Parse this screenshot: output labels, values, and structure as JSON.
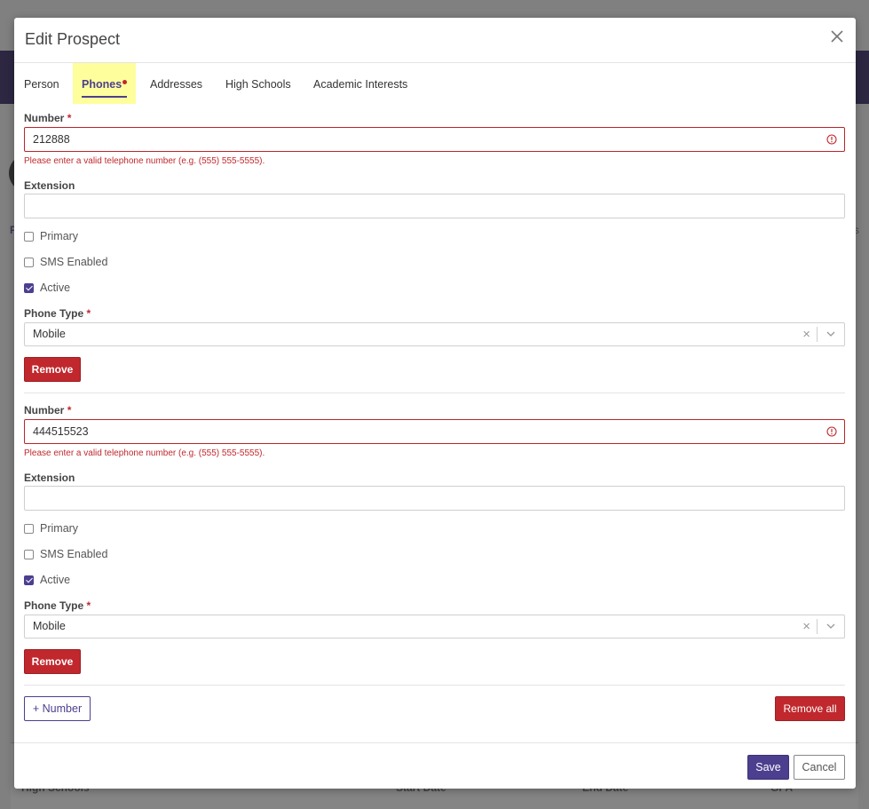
{
  "background": {
    "letter_left": "P",
    "letter_right": "s",
    "table_columns": [
      "High Schools",
      "Start Date",
      "End Date",
      "GPA"
    ]
  },
  "modal": {
    "title": "Edit Prospect",
    "close_icon": "close-icon",
    "tabs": [
      {
        "label": "Person",
        "active": false
      },
      {
        "label": "Phones",
        "active": true,
        "has_error": true
      },
      {
        "label": "Addresses",
        "active": false
      },
      {
        "label": "High Schools",
        "active": false
      },
      {
        "label": "Academic Interests",
        "active": false
      }
    ],
    "phones": [
      {
        "number_label": "Number",
        "number_value": "212888",
        "error_text": "Please enter a valid telephone number (e.g. (555) 555-5555).",
        "extension_label": "Extension",
        "extension_value": "",
        "primary_label": "Primary",
        "primary_checked": false,
        "sms_label": "SMS Enabled",
        "sms_checked": false,
        "active_label": "Active",
        "active_checked": true,
        "phone_type_label": "Phone Type",
        "phone_type_value": "Mobile",
        "remove_label": "Remove"
      },
      {
        "number_label": "Number",
        "number_value": "444515523",
        "error_text": "Please enter a valid telephone number (e.g. (555) 555-5555).",
        "extension_label": "Extension",
        "extension_value": "",
        "primary_label": "Primary",
        "primary_checked": false,
        "sms_label": "SMS Enabled",
        "sms_checked": false,
        "active_label": "Active",
        "active_checked": true,
        "phone_type_label": "Phone Type",
        "phone_type_value": "Mobile",
        "remove_label": "Remove"
      }
    ],
    "required_marker": "*",
    "add_number_label": "+ Number",
    "remove_all_label": "Remove all",
    "save_label": "Save",
    "cancel_label": "Cancel",
    "colors": {
      "accent": "#4c3f8f",
      "danger": "#c0282d",
      "active_tab_highlight": "#fefe9c"
    }
  }
}
